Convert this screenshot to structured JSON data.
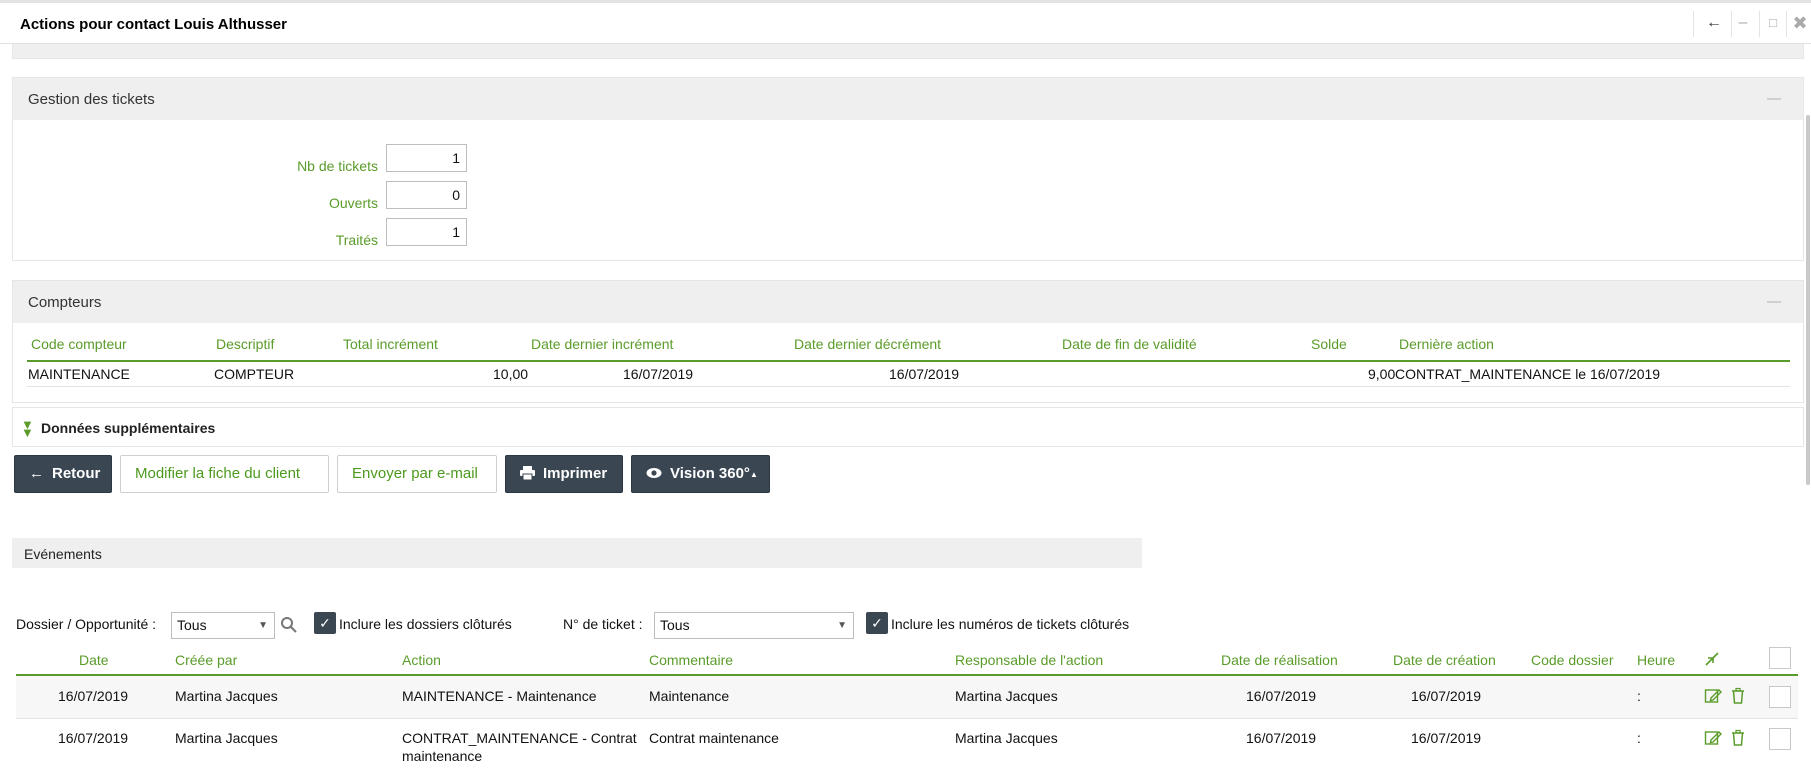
{
  "window": {
    "title": "Actions pour contact Louis Althusser",
    "controls": [
      "back-arrow-icon",
      "minimize-icon",
      "maximize-icon",
      "close-icon"
    ]
  },
  "tickets": {
    "title": "Gestion des tickets",
    "fields": [
      {
        "label": "Nb de tickets",
        "value": "1"
      },
      {
        "label": "Ouverts",
        "value": "0"
      },
      {
        "label": "Traités",
        "value": "1"
      }
    ]
  },
  "compteurs": {
    "title": "Compteurs",
    "headers": [
      "Code compteur",
      "Descriptif",
      "Total incrément",
      "Date dernier incrément",
      "Date dernier décrément",
      "Date de fin de validité",
      "Solde",
      "Dernière action"
    ],
    "rows": [
      [
        "MAINTENANCE",
        "COMPTEUR",
        "10,00",
        "16/07/2019",
        "16/07/2019",
        "",
        "9,00",
        "CONTRAT_MAINTENANCE le 16/07/2019"
      ]
    ]
  },
  "extra": {
    "label": "Données supplémentaires"
  },
  "buttons": {
    "retour": "Retour",
    "modifier": "Modifier la fiche du client",
    "email": "Envoyer par e-mail",
    "imprimer": "Imprimer",
    "vision": "Vision 360°"
  },
  "events": {
    "title": "Evénements",
    "filters": {
      "dossier_label": "Dossier / Opportunité :",
      "dossier_value": "Tous",
      "include_dossiers": "Inclure les dossiers clôturés",
      "ticket_label": "N° de ticket :",
      "ticket_value": "Tous",
      "include_tickets": "Inclure les numéros de tickets clôturés"
    },
    "headers": [
      "Date",
      "Créée par",
      "Action",
      "Commentaire",
      "Responsable de l'action",
      "Date de réalisation",
      "Date de création",
      "Code dossier",
      "Heure"
    ],
    "rows": [
      {
        "date": "16/07/2019",
        "creee_par": "Martina Jacques",
        "action": "MAINTENANCE - Maintenance",
        "commentaire": "Maintenance",
        "responsable": "Martina Jacques",
        "realisation": "16/07/2019",
        "creation": "16/07/2019",
        "code_dossier": "",
        "heure": ":"
      },
      {
        "date": "16/07/2019",
        "creee_par": "Martina Jacques",
        "action": "CONTRAT_MAINTENANCE - Contrat maintenance",
        "commentaire": "Contrat maintenance",
        "responsable": "Martina Jacques",
        "realisation": "16/07/2019",
        "creation": "16/07/2019",
        "code_dossier": "",
        "heure": ":"
      }
    ]
  },
  "colors": {
    "accent": "#5a9c2a",
    "dark_button": "#3a4652"
  }
}
